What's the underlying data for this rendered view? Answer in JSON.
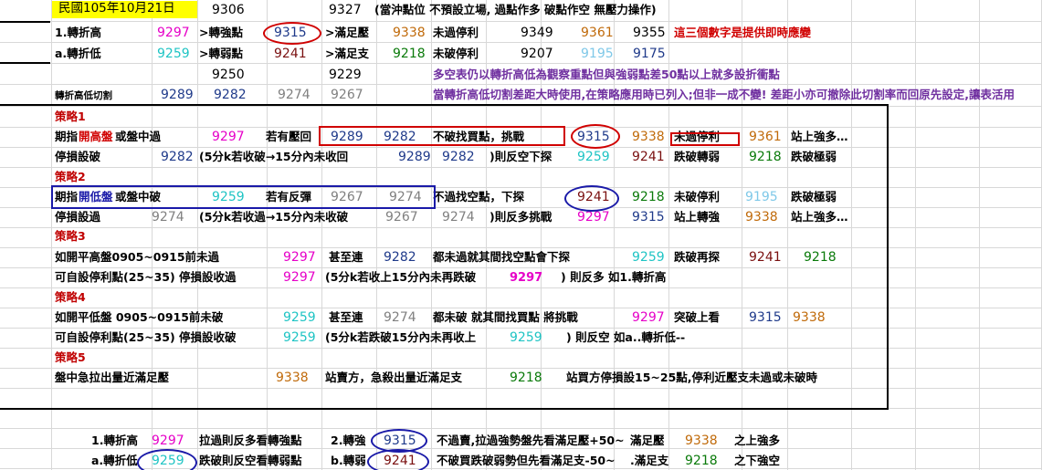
{
  "header": {
    "date": "民國105年10月21日",
    "n1": "9306",
    "n2": "9327",
    "note": "(當沖點位 不預設立場, 過點作多 破點作空 無壓力操作)"
  },
  "row1": {
    "label": "1.轉折高",
    "v1": "9297",
    "t1": ">轉強點",
    "v2": "9315",
    "t2": ">滿足壓",
    "v3": "9338",
    "t3": "未過停利",
    "v4": "9349",
    "v5": "9361",
    "v6": "9355",
    "note": "這三個數字是提供即時應變"
  },
  "row2": {
    "label": "a.轉折低",
    "v1": "9259",
    "t1": ">轉弱點",
    "v2": "9241",
    "t2": ">滿足支",
    "v3": "9218",
    "t3": "未破停利",
    "v4": "9207",
    "v5": "9195",
    "v6": "9175"
  },
  "row3": {
    "n1": "9250",
    "n2": "9229",
    "note": "多空表仍以轉折高低為觀察重點但與強弱點差50點以上就多設折衝點"
  },
  "row4": {
    "label": "轉折高低切割",
    "v1": "9289",
    "v2": "9282",
    "v3": "9274",
    "v4": "9267",
    "note": "當轉折高低切割差距大時使用,在策略應用時已列入;但非一成不變! 差距小亦可撤除此切割率而回原先設定,讓表活用"
  },
  "s1": {
    "title": "策略1",
    "a": {
      "p1": "期指",
      "hl": "開高盤",
      "p2": "或盤中過",
      "v1": "9297",
      "t1": "若有壓回",
      "v2": "9289",
      "v3": "9282",
      "t2": "不破找買點，挑戰",
      "v4": "9315",
      "v5": "9338",
      "t3": "未過停利",
      "v6": "9361",
      "t4": "站上強多…"
    },
    "b": {
      "t1": "停損設破",
      "v1": "9282",
      "t2": "(5分k若收破→15分內未收回",
      "v2": "9289",
      "v3": "9282",
      "t3": ")則反空下探",
      "v4": "9259",
      "v5": "9241",
      "t4": "跌破轉弱",
      "v6": "9218",
      "t5": "跌破極弱"
    }
  },
  "s2": {
    "title": "策略2",
    "a": {
      "p1": "期指",
      "hl": "開低盤",
      "p2": "或盤中破",
      "v1": "9259",
      "t1": "若有反彈",
      "v2": "9267",
      "v3": "9274",
      "t2": "不過找空點，下探",
      "v4": "9241",
      "v5": "9218",
      "t3": "未破停利",
      "v6": "9195",
      "t4": "跌破極弱"
    },
    "b": {
      "t1": "停損設過",
      "v1": "9274",
      "t2": "(5分k若收過→15分內未收破",
      "v2": "9267",
      "v3": "9274",
      "t3": ")則反多挑戰",
      "v4": "9297",
      "v5": "9315",
      "t4": "站上轉強",
      "v6": "9338",
      "t5": "站上強多…"
    }
  },
  "s3": {
    "title": "策略3",
    "a": {
      "t1": "如開平高盤0905~0915前未過",
      "v1": "9297",
      "t2": "甚至連",
      "v2": "9282",
      "t3": "都未過就其間找空點會下探",
      "v3": "9259",
      "t4": "跌破再探",
      "v4": "9241",
      "v5": "9218"
    },
    "b": {
      "t1": "可自設停利點(25~35) 停損設收過",
      "v1": "9297",
      "t2": "(5分k若收上15分內未再跌破",
      "v2": "9297",
      "t3": ") 則反多 如1.轉折高"
    }
  },
  "s4": {
    "title": "策略4",
    "a": {
      "t1": "如開平低盤 0905~0915前未破",
      "v1": "9259",
      "t2": "甚至連",
      "v2": "9274",
      "t3": "都未破 就其間找買點 將挑戰",
      "v3": "9297",
      "t4": "突破上看",
      "v4": "9315",
      "v5": "9338"
    },
    "b": {
      "t1": "可自設停利點(25~35) 停損設收破",
      "v1": "9259",
      "t2": "(5分k若跌破15分內未再收上",
      "v2": "9259",
      "t3": ") 則反空 如a..轉折低--"
    }
  },
  "s5": {
    "title": "策略5",
    "a": {
      "t1": "盤中急拉出量近滿足壓",
      "v1": "9338",
      "t2": "站賣方，急殺出量近滿足支",
      "v2": "9218",
      "t3": "站買方停損設15~25點,停利近壓支未過或未破時"
    }
  },
  "sum1": {
    "label": "1.轉折高",
    "v1": "9297",
    "t1": "拉過則反多看轉強點",
    "t2": "2.轉強",
    "v2": "9315",
    "t3": "不過賣,拉過強勢盤先看滿足壓+50~",
    "t4": "滿足壓",
    "v3": "9338",
    "t5": "之上強多"
  },
  "sum2": {
    "label": "a.轉折低",
    "v1": "9259",
    "t1": "跌破則反空看轉弱點",
    "t2": "b.轉弱",
    "v2": "9241",
    "t3": "不破買跌破弱勢但先看滿足支-50~",
    "t4": ".滿足支",
    "v3": "9218",
    "t5": "之下強空"
  }
}
